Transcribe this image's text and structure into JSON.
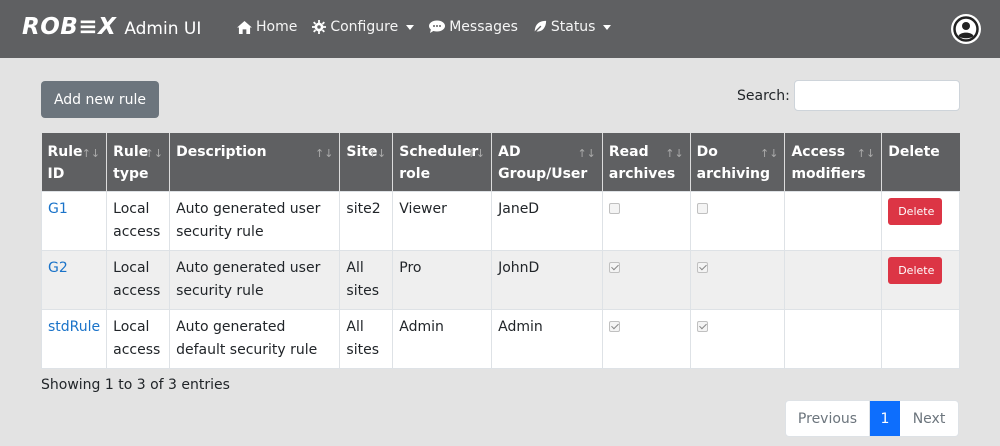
{
  "navbar": {
    "brand": "ROB≡X",
    "subtitle": "Admin UI",
    "items": [
      {
        "label": "Home",
        "icon": "home-icon"
      },
      {
        "label": "Configure",
        "icon": "gear-icon",
        "dropdown": true
      },
      {
        "label": "Messages",
        "icon": "comment-icon"
      },
      {
        "label": "Status",
        "icon": "leaf-icon",
        "dropdown": true
      }
    ],
    "user_icon": "user-circle-icon"
  },
  "toolbar": {
    "add_label": "Add new rule",
    "search_label": "Search:",
    "search_value": ""
  },
  "table": {
    "headers": [
      "Rule ID",
      "Rule type",
      "Description",
      "Site",
      "Scheduler role",
      "AD Group/User",
      "Read archives",
      "Do archiving",
      "Access modifiers",
      "Delete"
    ],
    "rows": [
      {
        "id": "G1",
        "type": "Local access",
        "description": "Auto generated user security rule",
        "site": "site2",
        "role": "Viewer",
        "ad": "JaneD",
        "read": false,
        "archive": false,
        "modifiers": "",
        "delete": "Delete"
      },
      {
        "id": "G2",
        "type": "Local access",
        "description": "Auto generated user security rule",
        "site": "All sites",
        "role": "Pro",
        "ad": "JohnD",
        "read": true,
        "archive": true,
        "modifiers": "",
        "delete": "Delete"
      },
      {
        "id": "stdRule",
        "type": "Local access",
        "description": "Auto generated default security rule",
        "site": "All sites",
        "role": "Admin",
        "ad": "Admin",
        "read": true,
        "archive": true,
        "modifiers": "",
        "delete": ""
      }
    ]
  },
  "footer": {
    "info": "Showing 1 to 3 of 3 entries",
    "prev": "Previous",
    "page": "1",
    "next": "Next"
  },
  "colors": {
    "navbar": "#5f6062",
    "danger": "#dc3545",
    "primary": "#0d6efd",
    "link": "#1a73c9"
  }
}
